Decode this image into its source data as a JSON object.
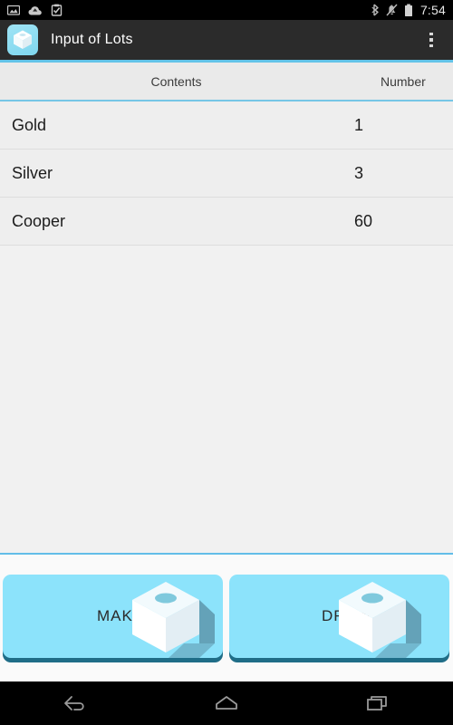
{
  "status_bar": {
    "notifications": [
      {
        "name": "screenshot-icon",
        "label": "Screenshot"
      },
      {
        "name": "cloud-upload-icon",
        "label": "Cloud upload"
      },
      {
        "name": "clipboard-check-icon",
        "label": "Clipboard"
      }
    ],
    "system": [
      {
        "name": "bluetooth-icon",
        "label": "Bluetooth"
      },
      {
        "name": "silent-mode-icon",
        "label": "Silent"
      },
      {
        "name": "battery-icon",
        "label": "Battery"
      }
    ],
    "time": "7:54"
  },
  "action_bar": {
    "app_icon": "lot-box-icon",
    "title": "Input of Lots",
    "overflow_label": "More options"
  },
  "table": {
    "headers": [
      "Contents",
      "Number"
    ],
    "rows": [
      {
        "contents": "Gold",
        "number": "1"
      },
      {
        "contents": "Silver",
        "number": "3"
      },
      {
        "contents": "Cooper",
        "number": "60"
      }
    ]
  },
  "buttons": [
    {
      "id": "make",
      "label": "MAKE",
      "icon": "lot-box-icon"
    },
    {
      "id": "draw",
      "label": "DRAW",
      "icon": "lot-box-icon"
    }
  ],
  "nav_bar": {
    "back": "back-icon",
    "home": "home-icon",
    "recents": "recents-icon"
  },
  "colors": {
    "accent": "#63c3e8",
    "button_fill": "#8ce3fb",
    "button_shadow": "#1f6d87",
    "action_bar": "#2b2b2b",
    "page_bg": "#f1f1f1"
  }
}
